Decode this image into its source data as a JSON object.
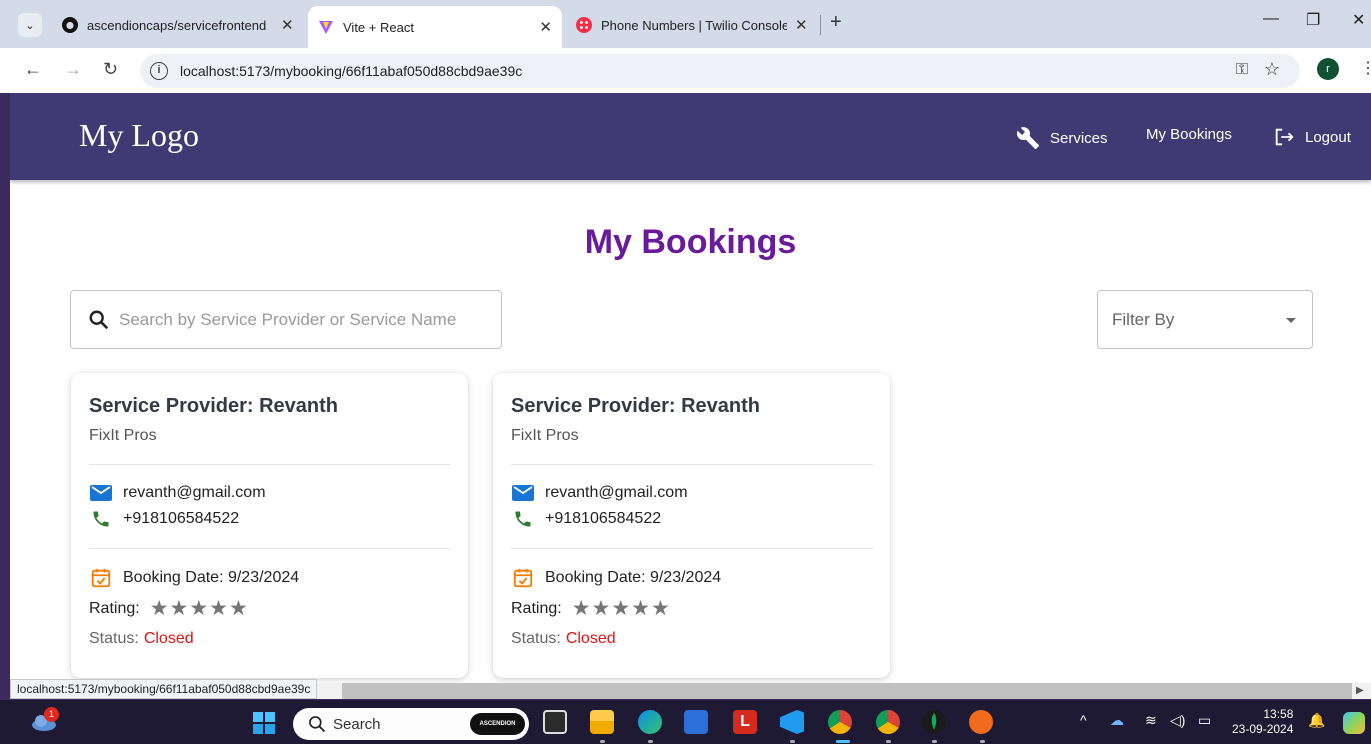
{
  "browser": {
    "tabs": [
      {
        "title": "ascendioncaps/servicefrontend",
        "active": false
      },
      {
        "title": "Vite + React",
        "active": true
      },
      {
        "title": "Phone Numbers | Twilio Console",
        "active": false
      }
    ],
    "url": "localhost:5173/mybooking/66f11abaf050d88cbd9ae39c",
    "profile_initial": "r"
  },
  "app": {
    "logo": "My Logo",
    "nav": {
      "services": "Services",
      "my_bookings": "My Bookings",
      "logout": "Logout"
    },
    "colors": {
      "appbar": "#3f3a73",
      "title": "#6a1b9a",
      "status_closed": "#e11414"
    }
  },
  "main": {
    "title": "My Bookings",
    "search_placeholder": "Search by Service Provider or Service Name",
    "filter_label": "Filter By"
  },
  "bookings": [
    {
      "provider": "Service Provider: Revanth",
      "business": "FixIt Pros",
      "email": "revanth@gmail.com",
      "phone": "+918106584522",
      "booking_date": "Booking Date: 9/23/2024",
      "rating_label": "Rating:",
      "rating_stars": "★★★★★",
      "status_label": "Status:",
      "status_value": "Closed"
    },
    {
      "provider": "Service Provider: Revanth",
      "business": "FixIt Pros",
      "email": "revanth@gmail.com",
      "phone": "+918106584522",
      "booking_date": "Booking Date: 9/23/2024",
      "rating_label": "Rating:",
      "rating_stars": "★★★★★",
      "status_label": "Status:",
      "status_value": "Closed"
    }
  ],
  "statusbar": {
    "hover_url": "localhost:5173/mybooking/66f11abaf050d88cbd9ae39c"
  },
  "taskbar": {
    "search_text": "Search",
    "search_pill": "ASCENDION",
    "weather_badge": "1",
    "time": "13:58",
    "date": "23-09-2024"
  }
}
